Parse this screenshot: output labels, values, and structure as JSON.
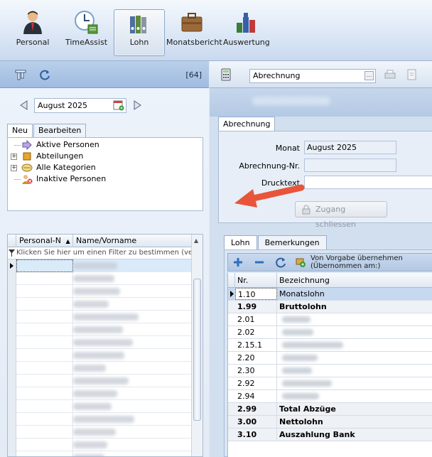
{
  "ribbon": {
    "items": [
      {
        "label": "Personal",
        "icon": "person-icon"
      },
      {
        "label": "TimeAssist",
        "icon": "clock-icon"
      },
      {
        "label": "Lohn",
        "icon": "binders-icon",
        "active": true
      },
      {
        "label": "Monatsbericht",
        "icon": "briefcase-icon"
      },
      {
        "label": "Auswertung",
        "icon": "chart-bottles-icon"
      }
    ]
  },
  "left": {
    "count": "[64]",
    "date": "August 2025",
    "tabs": [
      "Neu",
      "Bearbeiten"
    ],
    "tree": [
      {
        "label": "Aktive Personen",
        "icon": "arrow-right-icon",
        "expand": false
      },
      {
        "label": "Abteilungen",
        "icon": "folder-icon",
        "expand": true
      },
      {
        "label": "Alle Kategorien",
        "icon": "categories-icon",
        "expand": true
      },
      {
        "label": "Inaktive Personen",
        "icon": "inactive-persons-icon",
        "expand": false
      }
    ],
    "grid": {
      "col1": "Personal-N",
      "col2": "Name/Vorname",
      "filter_hint": "Klicken Sie hier um einen Filter zu bestimmen (ver"
    }
  },
  "right": {
    "combo": "Abrechnung",
    "tab": "Abrechnung",
    "form": {
      "monat_label": "Monat",
      "monat_value": "August 2025",
      "nr_label": "Abrechnung-Nr.",
      "nr_value": "",
      "drucktext_label": "Drucktext",
      "drucktext_value": "",
      "zugang_button": "Zugang schliessen"
    },
    "lohn_tabs": [
      "Lohn",
      "Bemerkungen"
    ],
    "toolbar": {
      "vorgabe_line1": "Von Vorgabe übernehmen",
      "vorgabe_line2": "(Übernommen am:)"
    },
    "grid": {
      "col_nr": "Nr.",
      "col_bez": "Bezeichnung",
      "rows": [
        {
          "nr": "1.10",
          "bez": "Monatslohn",
          "bold": false,
          "selected": true
        },
        {
          "nr": "1.99",
          "bez": "Bruttolohn",
          "bold": true
        },
        {
          "nr": "2.01",
          "bez": "",
          "bold": false
        },
        {
          "nr": "2.02",
          "bez": "",
          "bold": false
        },
        {
          "nr": "2.15.1",
          "bez": "",
          "bold": false
        },
        {
          "nr": "2.20",
          "bez": "",
          "bold": false
        },
        {
          "nr": "2.30",
          "bez": "",
          "bold": false
        },
        {
          "nr": "2.92",
          "bez": "",
          "bold": false
        },
        {
          "nr": "2.94",
          "bez": "",
          "bold": false
        },
        {
          "nr": "2.99",
          "bez": "Total Abzüge",
          "bold": true
        },
        {
          "nr": "3.00",
          "bez": "Nettolohn",
          "bold": true
        },
        {
          "nr": "3.10",
          "bez": "Auszahlung Bank",
          "bold": true
        }
      ]
    }
  },
  "colors": {
    "accent_arrow": "#e8553a",
    "selection": "#c7d9ee"
  }
}
